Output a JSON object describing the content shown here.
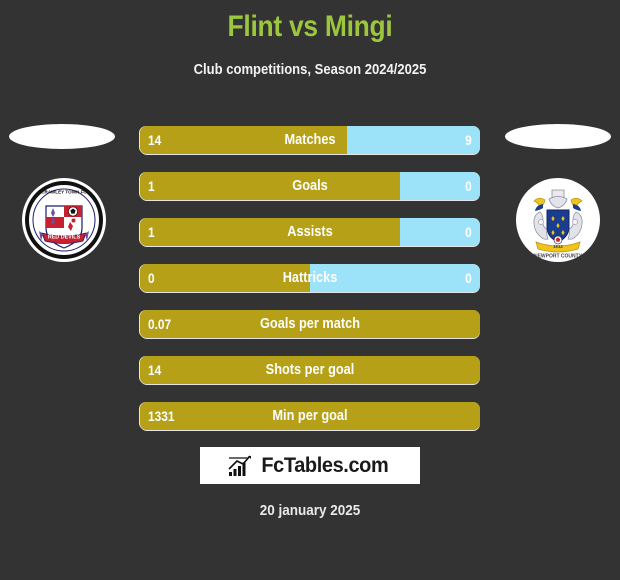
{
  "header": {
    "title": "Flint vs Mingi",
    "subtitle": "Club competitions, Season 2024/2025",
    "title_color": "#9cc63d"
  },
  "theme": {
    "background": "#333333",
    "home_color": "#b5a018",
    "away_color": "#9ce3fa",
    "text_color": "#ffffff"
  },
  "badges": {
    "home": {
      "name": "crawley-town-fc-badge",
      "club": "Crawley Town FC",
      "nickname": "Red Devils"
    },
    "away": {
      "name": "newport-county-badge",
      "club": "Newport County"
    }
  },
  "chart_data": {
    "type": "bar",
    "title": "Flint vs Mingi",
    "subtitle": "Club competitions, Season 2024/2025",
    "orientation": "horizontal-diverging",
    "legend": [
      "Flint",
      "Mingi"
    ],
    "categories": [
      "Matches",
      "Goals",
      "Assists",
      "Hattricks",
      "Goals per match",
      "Shots per goal",
      "Min per goal"
    ],
    "series": [
      {
        "name": "Flint",
        "color": "#b5a018",
        "values": [
          14,
          1,
          1,
          0,
          0.07,
          14,
          1331
        ]
      },
      {
        "name": "Mingi",
        "color": "#9ce3fa",
        "values": [
          9,
          0,
          0,
          0,
          null,
          null,
          null
        ]
      }
    ],
    "rows": [
      {
        "label": "Matches",
        "home": "14",
        "away": "9",
        "home_pct": 60.9,
        "has_away": true
      },
      {
        "label": "Goals",
        "home": "1",
        "away": "0",
        "home_pct": 76.5,
        "has_away": true
      },
      {
        "label": "Assists",
        "home": "1",
        "away": "0",
        "home_pct": 76.5,
        "has_away": true
      },
      {
        "label": "Hattricks",
        "home": "0",
        "away": "0",
        "home_pct": 50.0,
        "has_away": true
      },
      {
        "label": "Goals per match",
        "home": "0.07",
        "away": "",
        "home_pct": 100,
        "has_away": false
      },
      {
        "label": "Shots per goal",
        "home": "14",
        "away": "",
        "home_pct": 100,
        "has_away": false
      },
      {
        "label": "Min per goal",
        "home": "1331",
        "away": "",
        "home_pct": 100,
        "has_away": false
      }
    ]
  },
  "footer": {
    "logo_text": "FcTables.com",
    "logo_icon": "bar-chart-icon",
    "date": "20 january 2025"
  }
}
